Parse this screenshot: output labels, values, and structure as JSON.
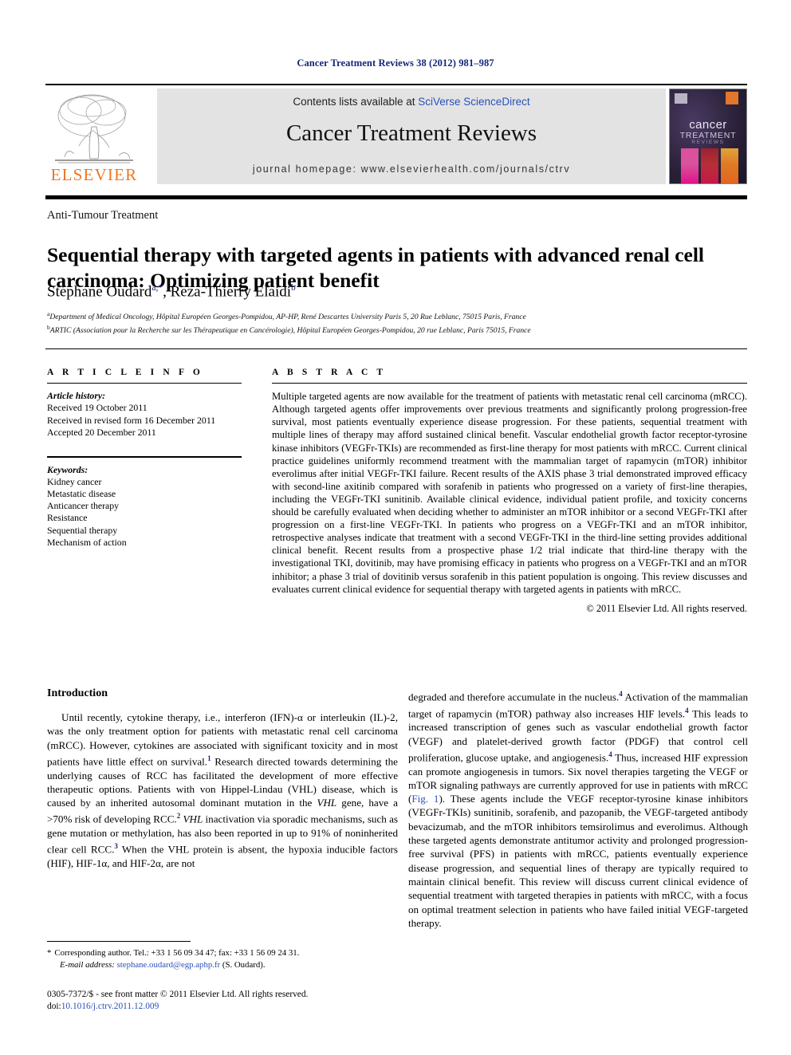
{
  "running_head": "Cancer Treatment Reviews 38 (2012) 981–987",
  "masthead": {
    "publisher_name": "ELSEVIER",
    "contents_prefix": "Contents lists available at ",
    "sciencedirect": "SciVerse ScienceDirect",
    "journal_title": "Cancer Treatment Reviews",
    "homepage": "journal homepage: www.elsevierhealth.com/journals/ctrv",
    "cover": {
      "title": "cancer",
      "subtitle": "TREATMENT",
      "subtitle2": "REVIEWS"
    }
  },
  "article": {
    "kicker": "Anti-Tumour Treatment",
    "title": "Sequential therapy with targeted agents in patients with advanced renal cell carcinoma: Optimizing patient benefit",
    "authors": [
      {
        "name": "Stéphane Oudard",
        "marks": "a,*"
      },
      {
        "name": "Reza-Thierry Elaidi",
        "marks": "b"
      }
    ],
    "affiliations": [
      {
        "mark": "a",
        "text": "Department of Medical Oncology, Hôpital Européen Georges-Pompidou, AP-HP, René Descartes University Paris 5, 20 Rue Leblanc, 75015 Paris, France"
      },
      {
        "mark": "b",
        "text": "ARTIC (Association pour la Recherche sur les Thérapeutique en Cancérologie), Hôpital Européen Georges-Pompidou, 20 rue Leblanc, Paris 75015, France"
      }
    ]
  },
  "article_info": {
    "heading": "A R T I C L E    I N F O",
    "history_label": "Article history:",
    "history": [
      "Received 19 October 2011",
      "Received in revised form 16 December 2011",
      "Accepted 20 December 2011"
    ],
    "keywords_label": "Keywords:",
    "keywords": [
      "Kidney cancer",
      "Metastatic disease",
      "Anticancer therapy",
      "Resistance",
      "Sequential therapy",
      "Mechanism of action"
    ]
  },
  "abstract": {
    "heading": "A B S T R A C T",
    "text": "Multiple targeted agents are now available for the treatment of patients with metastatic renal cell carcinoma (mRCC). Although targeted agents offer improvements over previous treatments and significantly prolong progression-free survival, most patients eventually experience disease progression. For these patients, sequential treatment with multiple lines of therapy may afford sustained clinical benefit. Vascular endothelial growth factor receptor-tyrosine kinase inhibitors (VEGFr-TKIs) are recommended as first-line therapy for most patients with mRCC. Current clinical practice guidelines uniformly recommend treatment with the mammalian target of rapamycin (mTOR) inhibitor everolimus after initial VEGFr-TKI failure. Recent results of the AXIS phase 3 trial demonstrated improved efficacy with second-line axitinib compared with sorafenib in patients who progressed on a variety of first-line therapies, including the VEGFr-TKI sunitinib. Available clinical evidence, individual patient profile, and toxicity concerns should be carefully evaluated when deciding whether to administer an mTOR inhibitor or a second VEGFr-TKI after progression on a first-line VEGFr-TKI. In patients who progress on a VEGFr-TKI and an mTOR inhibitor, retrospective analyses indicate that treatment with a second VEGFr-TKI in the third-line setting provides additional clinical benefit. Recent results from a prospective phase 1/2 trial indicate that third-line therapy with the investigational TKI, dovitinib, may have promising efficacy in patients who progress on a VEGFr-TKI and an mTOR inhibitor; a phase 3 trial of dovitinib versus sorafenib in this patient population is ongoing. This review discusses and evaluates current clinical evidence for sequential therapy with targeted agents in patients with mRCC.",
    "copyright": "© 2011 Elsevier Ltd. All rights reserved."
  },
  "body": {
    "intro_heading": "Introduction",
    "left_paragraph_1_a": "Until recently, cytokine therapy, i.e., interferon (IFN)-α or interleukin (IL)-2, was the only treatment option for patients with metastatic renal cell carcinoma (mRCC). However, cytokines are associated with significant toxicity and in most patients have little effect on survival.",
    "left_ref_1": "1",
    "left_paragraph_1_b": " Research directed towards determining the underlying causes of RCC has facilitated the development of more effective therapeutic options. Patients with von Hippel-Lindau (VHL) disease, which is caused by an inherited autosomal dominant mutation in the ",
    "left_italic_vhl_1": "VHL",
    "left_paragraph_1_c": " gene, have a >70% risk of developing RCC.",
    "left_ref_2": "2",
    "left_italic_vhl_2": " VHL",
    "left_paragraph_1_d": " inactivation via sporadic mechanisms, such as gene mutation or methylation, has also been reported in up to 91% of noninherited clear cell RCC.",
    "left_ref_3": "3",
    "left_paragraph_1_e": " When the VHL protein is absent, the hypoxia inducible factors (HIF), HIF-1α, and HIF-2α, are not",
    "right_paragraph_a": "degraded and therefore accumulate in the nucleus.",
    "right_ref_4a": "4",
    "right_paragraph_b": " Activation of the mammalian target of rapamycin (mTOR) pathway also increases HIF levels.",
    "right_ref_4b": "4",
    "right_paragraph_c": " This leads to increased transcription of genes such as vascular endothelial growth factor (VEGF) and platelet-derived growth factor (PDGF) that control cell proliferation, glucose uptake, and angiogenesis.",
    "right_ref_4c": "4",
    "right_paragraph_d": " Thus, increased HIF expression can promote angiogenesis in tumors. Six novel therapies targeting the VEGF or mTOR signaling pathways are currently approved for use in patients with mRCC (",
    "right_fig_link": "Fig. 1",
    "right_paragraph_e": "). These agents include the VEGF receptor-tyrosine kinase inhibitors (VEGFr-TKIs) sunitinib, sorafenib, and pazopanib, the VEGF-targeted antibody bevacizumab, and the mTOR inhibitors temsirolimus and everolimus. Although these targeted agents demonstrate antitumor activity and prolonged progression-free survival (PFS) in patients with mRCC, patients eventually experience disease progression, and sequential lines of therapy are typically required to maintain clinical benefit. This review will discuss current clinical evidence of sequential treatment with targeted therapies in patients with mRCC, with a focus on optimal treatment selection in patients who have failed initial VEGF-targeted therapy."
  },
  "footer": {
    "corresponding_star": "*",
    "corresponding_line": "Corresponding author. Tel.: +33 1 56 09 34 47; fax: +33 1 56 09 24 31.",
    "email_label": "E-mail address:",
    "email": "stephane.oudard@egp.aphp.fr",
    "email_suffix": " (S. Oudard).",
    "issn_line": "0305-7372/$ - see front matter © 2011 Elsevier Ltd. All rights reserved.",
    "doi_label": "doi:",
    "doi": "10.1016/j.ctrv.2011.12.009"
  },
  "colors": {
    "link_blue": "#2b52bb",
    "navy": "#13277a",
    "elsevier_orange": "#ee7623",
    "banner_gray": "#e3e3e3"
  }
}
